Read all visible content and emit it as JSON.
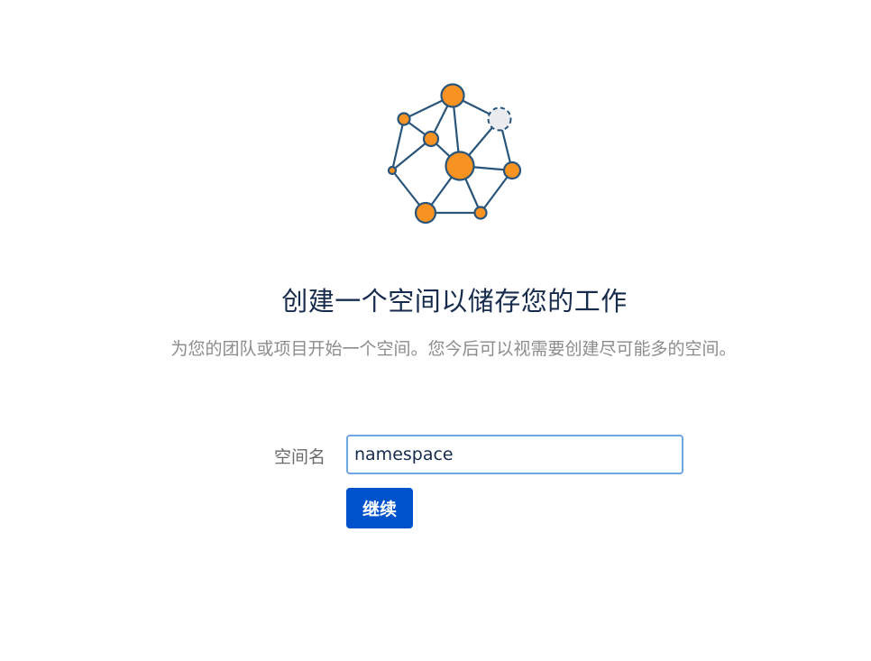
{
  "illustration": {
    "icon": "network-graph-icon",
    "colors": {
      "node_fill": "#f89220",
      "node_stroke": "#2a557b",
      "edge": "#2a557b",
      "empty_node_fill": "#ebecf0"
    }
  },
  "heading": "创建一个空间以储存您的工作",
  "description": "为您的团队或项目开始一个空间。您今后可以视需要创建尽可能多的空间。",
  "form": {
    "label": "空间名",
    "input_value": "namespace",
    "continue_label": "继续"
  },
  "colors": {
    "primary": "#0052cc",
    "heading": "#172b4d",
    "input_border": "#6fa7e6"
  }
}
